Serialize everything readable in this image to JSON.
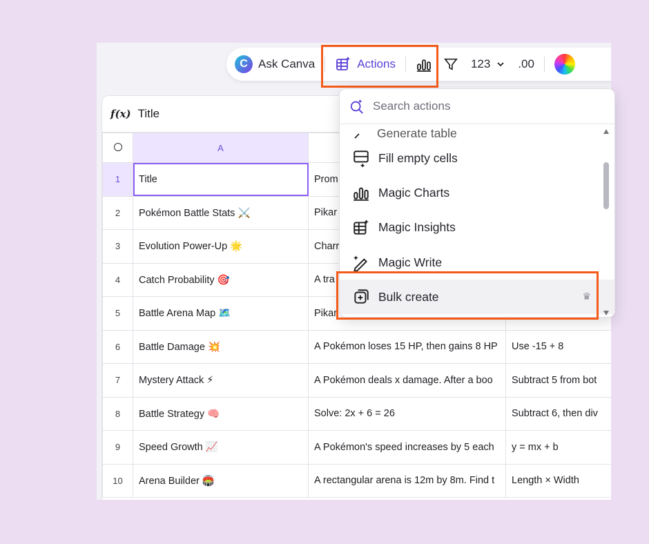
{
  "toolbar": {
    "ask_canva": "Ask Canva",
    "actions": "Actions",
    "number_format": "123",
    "decimals": ".00"
  },
  "formula_bar": {
    "fx": "f(x)",
    "value": "Title"
  },
  "grid": {
    "col_a_header": "A",
    "rows": [
      {
        "num": "1",
        "a": "Title",
        "b": "Prom",
        "c": ""
      },
      {
        "num": "2",
        "a": "Pokémon Battle Stats ⚔️",
        "b": "Pikar",
        "c": ""
      },
      {
        "num": "3",
        "a": "Evolution Power-Up 🌟",
        "b": "Charr",
        "c": ""
      },
      {
        "num": "4",
        "a": "Catch Probability 🎯",
        "b": "A tra",
        "c": ""
      },
      {
        "num": "5",
        "a": "Battle Arena Map 🗺️",
        "b": "Pikar",
        "c": ""
      },
      {
        "num": "6",
        "a": "Battle Damage 💥",
        "b": "A Pokémon loses 15 HP, then gains 8 HP",
        "c": "Use -15 + 8"
      },
      {
        "num": "7",
        "a": "Mystery Attack ⚡",
        "b": "A Pokémon deals x damage. After a boo",
        "c": "Subtract 5 from bot"
      },
      {
        "num": "8",
        "a": "Battle Strategy 🧠",
        "b": "Solve: 2x + 6 = 26",
        "c": "Subtract 6, then div"
      },
      {
        "num": "9",
        "a": "Speed Growth 📈",
        "b": "A Pokémon's speed increases by 5 each",
        "c": "y = mx + b"
      },
      {
        "num": "10",
        "a": "Arena Builder 🏟️",
        "b": "A rectangular arena is 12m by 8m. Find t",
        "c": "Length × Width"
      }
    ]
  },
  "dropdown": {
    "search_placeholder": "Search actions",
    "partial_item": "Generate table",
    "items": [
      {
        "label": "Fill empty cells",
        "icon": "fill-cells-icon"
      },
      {
        "label": "Magic Charts",
        "icon": "magic-charts-icon"
      },
      {
        "label": "Magic Insights",
        "icon": "magic-insights-icon"
      },
      {
        "label": "Magic Write",
        "icon": "magic-write-icon"
      },
      {
        "label": "Bulk create",
        "icon": "bulk-create-icon"
      }
    ],
    "crown": "♛"
  },
  "colors": {
    "accent": "#5a3fd6",
    "highlight": "#f55a1a",
    "background": "#ecddf3"
  }
}
